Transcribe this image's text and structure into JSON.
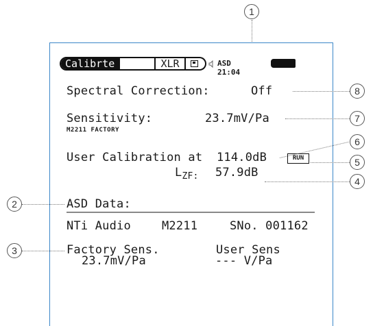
{
  "topbar": {
    "calib_tab": "Calibrte",
    "xlr_tab": "XLR",
    "status_text": "ASD 21:04"
  },
  "spectral": {
    "label": "Spectral Correction:",
    "value": "Off"
  },
  "sensitivity": {
    "label": "Sensitivity:",
    "value": "23.7mV/Pa",
    "source": "M2211 FACTORY"
  },
  "user_cal": {
    "label": "User Calibration at",
    "value": "114.0dB",
    "run_button": "RUN"
  },
  "lzf": {
    "label": "L",
    "sub": "ZF:",
    "value": "57.9dB"
  },
  "asd": {
    "heading": "ASD Data:",
    "maker": "NTi Audio",
    "model": "M2211",
    "serial": "SNo. 001162",
    "factory_label": "Factory Sens.",
    "factory_value": "23.7mV/Pa",
    "user_label": "User Sens",
    "user_value": "---  V/Pa"
  },
  "callouts": [
    "1",
    "2",
    "3",
    "4",
    "5",
    "6",
    "7",
    "8"
  ],
  "colors": {
    "frame": "#3a86c8",
    "lcd_text": "#1a1a1a",
    "callout_line": "#777777"
  },
  "icons": [
    "speaker-icon",
    "floppy-icon",
    "battery-icon"
  ]
}
